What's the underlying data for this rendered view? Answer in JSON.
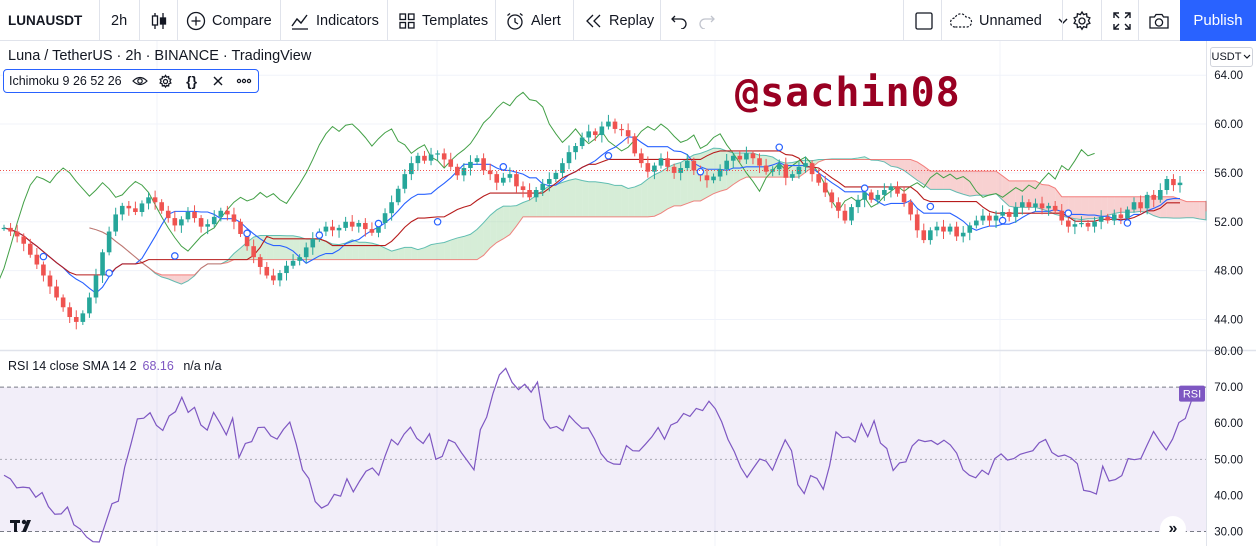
{
  "toolbar": {
    "symbol": "LUNAUSDT",
    "interval": "2h",
    "compare_label": "Compare",
    "indicators_label": "Indicators",
    "templates_label": "Templates",
    "alert_label": "Alert",
    "replay_label": "Replay",
    "layout_name": "Unnamed",
    "publish_label": "Publish"
  },
  "legend": {
    "title": "Luna / TetherUS · 2h · BINANCE · TradingView",
    "ichimoku_name": "Ichimoku",
    "ichimoku_params": "9 26 52 26"
  },
  "watermark": "@sachin08",
  "rsi_legend": {
    "label": "RSI 14 close SMA 14 2",
    "value": "68.16",
    "extra": "n/a n/a",
    "badge": "RSI"
  },
  "price_scale": {
    "currency": "USDT"
  },
  "colors": {
    "up": "#26a69a",
    "down": "#ef5350",
    "tenkan": "#2962ff",
    "kijun": "#b71c1c",
    "lagging": "#43a047",
    "cloud_bull": "#a5d6a7",
    "cloud_bear": "#ef9a9a",
    "rsi": "#7e57c2",
    "accent": "#2962ff"
  },
  "chart_data": {
    "type": "candlestick",
    "price_axis": {
      "ticks": [
        "64.00",
        "60.00",
        "56.00",
        "52.00",
        "48.00",
        "44.00"
      ],
      "range": [
        41.5,
        66.8
      ]
    },
    "rsi_axis": {
      "ticks": [
        "80.00",
        "70.00",
        "60.00",
        "50.00",
        "40.00",
        "30.00"
      ],
      "range": [
        26,
        80
      ],
      "bands": [
        30,
        70
      ],
      "mid": 50
    },
    "last_price": 56.2,
    "closes": [
      51.5,
      51.2,
      50.8,
      50.2,
      49.3,
      48.5,
      47.6,
      46.7,
      45.8,
      45.0,
      44.2,
      43.8,
      44.5,
      45.8,
      47.6,
      49.5,
      51.2,
      52.6,
      53.3,
      53.1,
      52.8,
      53.5,
      54.0,
      53.6,
      52.9,
      52.3,
      51.7,
      52.2,
      52.8,
      52.3,
      51.6,
      51.8,
      52.4,
      52.9,
      52.6,
      52.0,
      51.0,
      50.0,
      49.1,
      48.3,
      47.6,
      47.2,
      47.8,
      48.4,
      48.8,
      49.1,
      49.9,
      50.6,
      51.2,
      51.6,
      51.3,
      51.5,
      52.0,
      51.6,
      51.9,
      51.4,
      51.1,
      51.9,
      52.7,
      53.6,
      54.7,
      55.9,
      56.8,
      57.4,
      57.0,
      57.5,
      57.6,
      57.1,
      56.5,
      55.8,
      56.4,
      56.9,
      57.2,
      56.2,
      55.9,
      55.2,
      55.6,
      55.9,
      54.9,
      54.6,
      54.0,
      54.6,
      55.1,
      55.5,
      56.0,
      56.8,
      57.7,
      58.2,
      58.9,
      59.4,
      59.1,
      59.8,
      60.2,
      59.6,
      59.5,
      59.0,
      57.6,
      56.8,
      56.1,
      56.6,
      57.2,
      56.5,
      56.0,
      56.4,
      57.0,
      56.2,
      55.8,
      55.4,
      55.7,
      56.3,
      57.0,
      57.4,
      57.1,
      57.6,
      57.2,
      56.6,
      56.1,
      56.3,
      56.7,
      55.6,
      55.9,
      56.5,
      56.8,
      55.9,
      55.2,
      54.4,
      53.6,
      52.9,
      52.1,
      53.2,
      53.8,
      54.4,
      53.8,
      54.2,
      54.6,
      54.9,
      54.3,
      53.6,
      52.6,
      51.3,
      50.5,
      51.3,
      51.6,
      51.2,
      51.6,
      50.8,
      51.1,
      51.7,
      52.1,
      52.5,
      52.1,
      52.5,
      52.8,
      52.4,
      53.2,
      53.6,
      53.2,
      53.5,
      53.1,
      53.3,
      52.9,
      52.1,
      51.6,
      51.8,
      51.9,
      51.6,
      52.0,
      52.4,
      52.1,
      52.6,
      52.3,
      53.0,
      53.6,
      53.1,
      54.2,
      53.8,
      54.6,
      55.5,
      55.0,
      55.2
    ],
    "rsi": [
      45.6,
      44.6,
      42.1,
      42.3,
      42.1,
      39.5,
      40.8,
      36.9,
      34.8,
      34.9,
      36.8,
      31.9,
      30.7,
      28.5,
      27.2,
      27.1,
      32.4,
      37.7,
      38.4,
      47.8,
      54.3,
      61.2,
      61.4,
      62.9,
      59.4,
      58.0,
      62.0,
      63.2,
      67.2,
      63.0,
      64.4,
      59.5,
      58.1,
      63.0,
      60.1,
      56.8,
      61.4,
      50.5,
      54.4,
      54.9,
      58.8,
      58.9,
      56.5,
      55.6,
      58.3,
      60.3,
      54.3,
      47.1,
      44.7,
      38.3,
      36.5,
      37.4,
      40.3,
      39.8,
      44.6,
      41.0,
      44.0,
      46.7,
      47.6,
      45.6,
      50.9,
      55.5,
      54.0,
      57.0,
      58.9,
      55.8,
      54.4,
      57.1,
      50.0,
      50.8,
      55.4,
      54.6,
      51.9,
      49.5,
      47.1,
      58.2,
      61.7,
      68.3,
      73.4,
      75.2,
      71.3,
      69.3,
      70.8,
      68.6,
      71.4,
      61.1,
      58.6,
      59.1,
      57.9,
      62.1,
      60.2,
      58.6,
      58.7,
      55.6,
      51.6,
      49.5,
      48.7,
      48.6,
      53.8,
      52.4,
      52.3,
      54.2,
      56.2,
      58.8,
      55.6,
      59.5,
      60.3,
      62.7,
      61.9,
      64.1,
      63.5,
      66.1,
      64.0,
      60.4,
      55.5,
      52.1,
      47.8,
      45.0,
      47.6,
      50.1,
      49.5,
      47.0,
      51.3,
      55.4,
      52.4,
      43.0,
      40.5,
      45.5,
      44.7,
      41.7,
      48.3,
      57.6,
      56.0,
      56.2,
      54.8,
      59.9,
      56.3,
      60.7,
      54.5,
      53.0,
      46.9,
      49.0,
      49.3,
      53.7,
      55.4,
      54.9,
      55.2,
      54.1,
      55.3,
      54.0,
      51.7,
      47.1,
      45.6,
      44.9,
      47.0,
      45.8,
      50.2,
      51.5,
      49.8,
      50.2,
      51.4,
      51.9,
      52.4,
      54.6,
      55.5,
      51.9,
      50.8,
      51.2,
      50.4,
      48.8,
      41.4,
      41.1,
      40.4,
      48.1,
      44.0,
      44.4,
      45.5,
      50.2,
      49.9,
      50.2,
      54.0,
      57.7,
      55.0,
      52.6,
      55.6,
      60.2,
      61.3,
      66.4,
      68.2
    ]
  }
}
